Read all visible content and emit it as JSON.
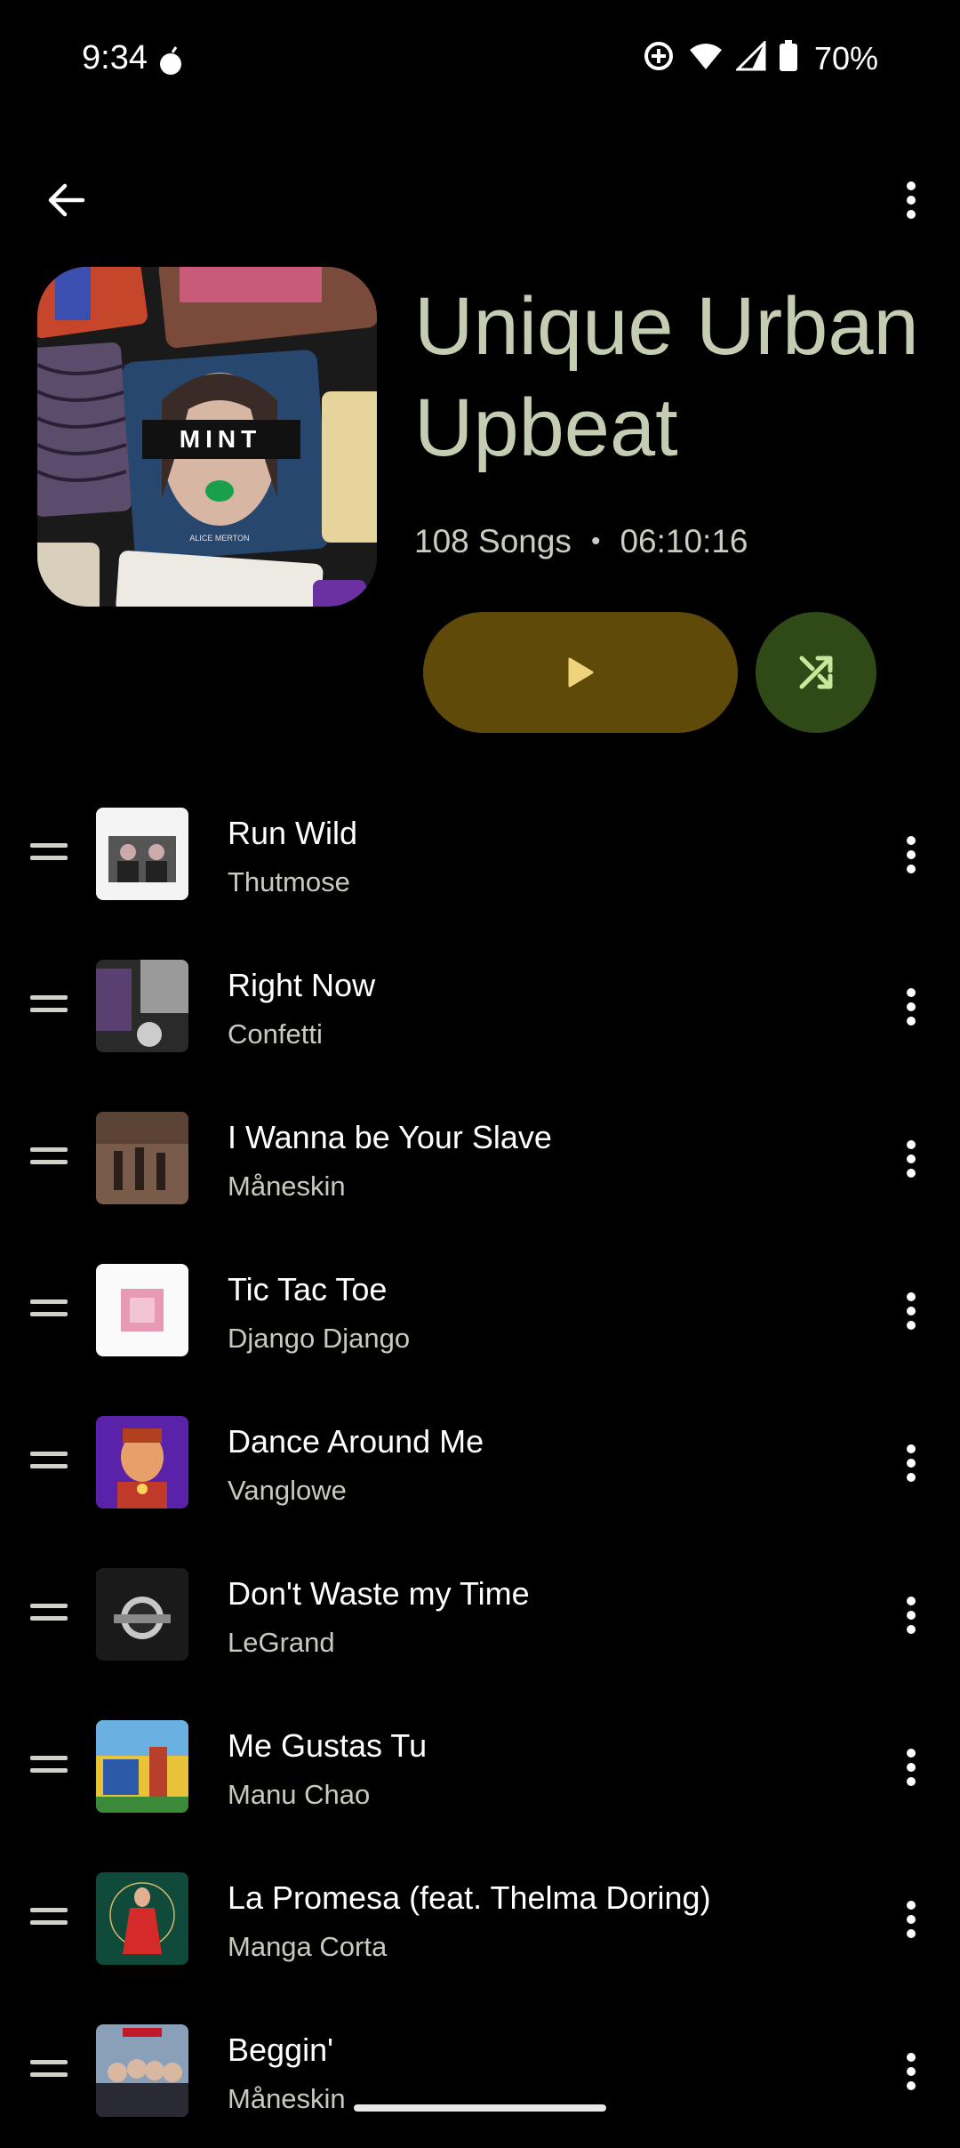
{
  "status": {
    "time": "9:34",
    "battery": "70%"
  },
  "playlist": {
    "title": "Unique Urban Upbeat",
    "song_count": "108 Songs",
    "separator": "•",
    "duration": "06:10:16",
    "cover_label": "MINT",
    "cover_sub": "ALICE MERTON"
  },
  "songs": [
    {
      "title": "Run Wild",
      "artist": "Thutmose"
    },
    {
      "title": "Right Now",
      "artist": "Confetti"
    },
    {
      "title": "I Wanna be Your Slave",
      "artist": "Måneskin"
    },
    {
      "title": "Tic Tac Toe",
      "artist": "Django Django"
    },
    {
      "title": "Dance Around Me",
      "artist": "Vanglowe"
    },
    {
      "title": "Don't Waste my Time",
      "artist": "LeGrand"
    },
    {
      "title": "Me Gustas Tu",
      "artist": "Manu Chao"
    },
    {
      "title": "La Promesa (feat. Thelma Doring)",
      "artist": "Manga Corta"
    },
    {
      "title": "Beggin'",
      "artist": "Måneskin"
    }
  ],
  "colors": {
    "title": "#c4ccb2",
    "play_button": "#5f4a09",
    "shuffle_button": "#2f4a17",
    "play_icon": "#f0d27a",
    "shuffle_icon": "#c8e79a"
  }
}
